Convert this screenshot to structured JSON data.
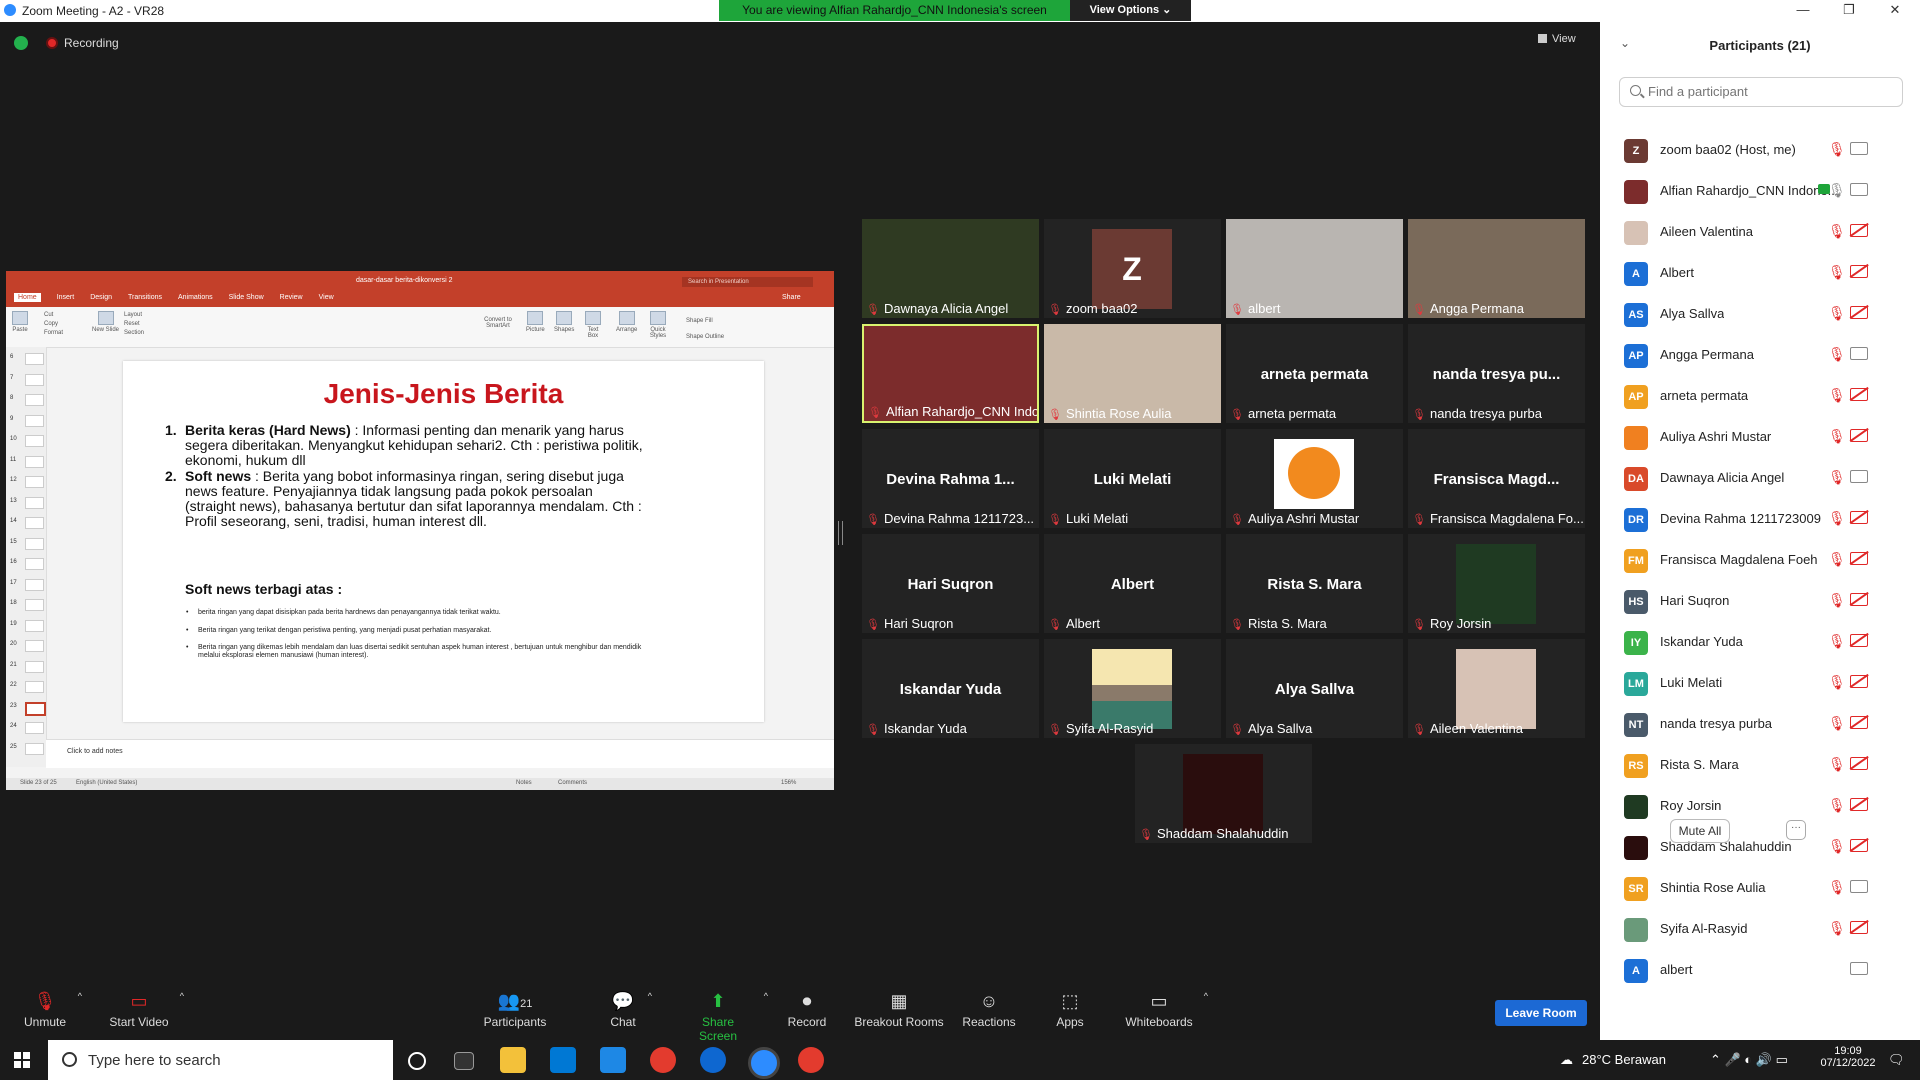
{
  "window": {
    "title": "Zoom Meeting - A2 - VR28",
    "minimize": "—",
    "maximize": "❐",
    "close": "✕"
  },
  "banner": {
    "viewing": "You are viewing Alfian Rahardjo_CNN Indonesia's screen",
    "view_options": "View Options"
  },
  "recording": {
    "label": "Recording"
  },
  "view_button": {
    "label": "View"
  },
  "ppt": {
    "doc_title": "dasar-dasar berita-dikonversi 2",
    "search_placeholder": "Search in Presentation",
    "tabs": [
      "Home",
      "Insert",
      "Design",
      "Transitions",
      "Animations",
      "Slide Show",
      "Review",
      "View"
    ],
    "share": "Share",
    "ribbon": {
      "paste": "Paste",
      "cut": "Cut",
      "copy": "Copy",
      "format": "Format",
      "new_slide": "New Slide",
      "layout": "Layout",
      "reset": "Reset",
      "section": "Section",
      "picture": "Picture",
      "shapes": "Shapes",
      "text_box": "Text Box",
      "arrange": "Arrange",
      "quick_styles": "Quick Styles",
      "shape_fill": "Shape Fill",
      "shape_outline": "Shape Outline",
      "convert": "Convert to SmartArt"
    },
    "thumb_numbers": [
      "6",
      "7",
      "8",
      "9",
      "10",
      "11",
      "12",
      "13",
      "14",
      "15",
      "16",
      "17",
      "18",
      "19",
      "20",
      "21",
      "22",
      "23",
      "24",
      "25"
    ],
    "slide": {
      "title": "Jenis-Jenis Berita",
      "item1_num": "1.",
      "item1_bold": "Berita keras (Hard News)",
      "item1_text": " : Informasi penting dan menarik yang harus segera diberitakan. Menyangkut kehidupan sehari2. Cth : peristiwa politik, ekonomi, hukum dll",
      "item2_num": "2.",
      "item2_bold": "Soft news",
      "item2_text": " : Berita yang bobot informasinya ringan, sering disebut juga news feature. Penyajiannya tidak langsung pada pokok persoalan (straight news), bahasanya bertutur dan sifat laporannya mendalam. Cth : Profil seseorang, seni, tradisi, human interest dll.",
      "subtitle": "Soft news terbagi atas :",
      "bullets": [
        "berita ringan yang dapat disisipkan pada berita hardnews dan penayangannya tidak terikat waktu.",
        "Berita ringan yang terikat dengan peristiwa penting, yang menjadi pusat perhatian masyarakat.",
        "Berita ringan yang dikemas lebih mendalam dan luas disertai sedikit sentuhan aspek human interest , bertujuan untuk menghibur dan mendidik melalui eksplorasi elemen manusiawi (human interest)."
      ]
    },
    "notes_placeholder": "Click to add notes",
    "status": {
      "slide": "Slide 23 of 25",
      "lang": "English (United States)",
      "notes": "Notes",
      "comments": "Comments",
      "zoom": "156%"
    }
  },
  "tiles": [
    {
      "name": "Dawnaya Alicia Angel",
      "big": "",
      "kind": "photo",
      "color": "#2f3a22"
    },
    {
      "name": "zoom baa02",
      "big": "",
      "kind": "avatar",
      "avatar": "Z"
    },
    {
      "name": "albert",
      "big": "",
      "kind": "photo",
      "color": "#b9b5b1"
    },
    {
      "name": "Angga Permana",
      "big": "",
      "kind": "photo",
      "color": "#7a6a5a"
    },
    {
      "name": "Alfian Rahardjo_CNN Indon...",
      "big": "",
      "kind": "photo",
      "color": "#7c2c2c"
    },
    {
      "name": "Shintia Rose Aulia",
      "big": "",
      "kind": "photo",
      "color": "#c9b9a8"
    },
    {
      "name": "arneta permata",
      "big": "arneta permata",
      "kind": "text"
    },
    {
      "name": "nanda tresya purba",
      "big": "nanda tresya pu...",
      "kind": "text"
    },
    {
      "name": "Devina Rahma 1211723...",
      "big": "Devina Rahma 1...",
      "kind": "text"
    },
    {
      "name": "Luki Melati",
      "big": "Luki Melati",
      "kind": "text"
    },
    {
      "name": "Auliya Ashri Mustar",
      "big": "",
      "kind": "orange"
    },
    {
      "name": "Fransisca Magdalena Fo...",
      "big": "Fransisca Magd...",
      "kind": "text"
    },
    {
      "name": "Hari Suqron",
      "big": "Hari Suqron",
      "kind": "text"
    },
    {
      "name": "Albert",
      "big": "Albert",
      "kind": "text"
    },
    {
      "name": "Rista S. Mara",
      "big": "Rista S. Mara",
      "kind": "text"
    },
    {
      "name": "Roy Jorsin",
      "big": "",
      "kind": "smallphoto",
      "color": "#1f3a22"
    },
    {
      "name": "Iskandar Yuda",
      "big": "Iskandar Yuda",
      "kind": "text"
    },
    {
      "name": "Syifa Al-Rasyid",
      "big": "",
      "kind": "landscape"
    },
    {
      "name": "Alya Sallva",
      "big": "Alya Sallva",
      "kind": "text"
    },
    {
      "name": "Aileen Valentina",
      "big": "",
      "kind": "smallphoto",
      "color": "#d7c2b5"
    },
    {
      "name": "Shaddam Shalahuddin",
      "big": "",
      "kind": "smallphoto",
      "color": "#2a0d0d"
    }
  ],
  "panel": {
    "title": "Participants (21)",
    "search_placeholder": "Find a participant",
    "mute_all": "Mute All",
    "more": "···",
    "participants": [
      {
        "name": "zoom baa02 (Host, me)",
        "initials": "Z",
        "color": "#6b3a33",
        "video": false
      },
      {
        "name": "Alfian Rahardjo_CNN Indone...",
        "initials": "",
        "color": "#7c2c2c",
        "video": false,
        "sharing": true,
        "mic_on": true
      },
      {
        "name": "Aileen Valentina",
        "initials": "",
        "color": "#d7c2b5",
        "video": true
      },
      {
        "name": "Albert",
        "initials": "A",
        "color": "#1c6fd6",
        "video": true
      },
      {
        "name": "Alya Sallva",
        "initials": "AS",
        "color": "#1c6fd6",
        "video": true
      },
      {
        "name": "Angga Permana",
        "initials": "AP",
        "color": "#1c6fd6",
        "video": false
      },
      {
        "name": "arneta permata",
        "initials": "AP",
        "color": "#f0a020",
        "video": true
      },
      {
        "name": "Auliya Ashri Mustar",
        "initials": "",
        "color": "#f08020",
        "video": true
      },
      {
        "name": "Dawnaya Alicia Angel",
        "initials": "DA",
        "color": "#d94a2a",
        "video": false
      },
      {
        "name": "Devina Rahma 1211723009",
        "initials": "DR",
        "color": "#1c6fd6",
        "video": true
      },
      {
        "name": "Fransisca Magdalena Foeh",
        "initials": "FM",
        "color": "#f0a020",
        "video": true
      },
      {
        "name": "Hari Suqron",
        "initials": "HS",
        "color": "#4a5a6a",
        "video": true
      },
      {
        "name": "Iskandar Yuda",
        "initials": "IY",
        "color": "#3bb34a",
        "video": true
      },
      {
        "name": "Luki Melati",
        "initials": "LM",
        "color": "#2aa89a",
        "video": true
      },
      {
        "name": "nanda tresya purba",
        "initials": "NT",
        "color": "#4a5a6a",
        "video": true
      },
      {
        "name": "Rista S. Mara",
        "initials": "RS",
        "color": "#f0a020",
        "video": true
      },
      {
        "name": "Roy Jorsin",
        "initials": "",
        "color": "#1f3a22",
        "video": true
      },
      {
        "name": "Shaddam Shalahuddin",
        "initials": "",
        "color": "#2a0d0d",
        "video": true
      },
      {
        "name": "Shintia Rose Aulia",
        "initials": "SR",
        "color": "#f0a020",
        "video": false
      },
      {
        "name": "Syifa Al-Rasyid",
        "initials": "",
        "color": "#6a9a7a",
        "video": true
      },
      {
        "name": "albert",
        "initials": "A",
        "color": "#1c6fd6",
        "video": false,
        "no_mic": true
      }
    ]
  },
  "toolbar": {
    "unmute": "Unmute",
    "start_video": "Start Video",
    "participants": "Participants",
    "participants_count": "21",
    "chat": "Chat",
    "share_screen": "Share Screen",
    "record": "Record",
    "breakout": "Breakout Rooms",
    "reactions": "Reactions",
    "apps": "Apps",
    "whiteboards": "Whiteboards",
    "leave": "Leave Room"
  },
  "taskbar": {
    "search": "Type here to search",
    "weather": "28°C  Berawan",
    "time": "19:09",
    "date": "07/12/2022"
  }
}
